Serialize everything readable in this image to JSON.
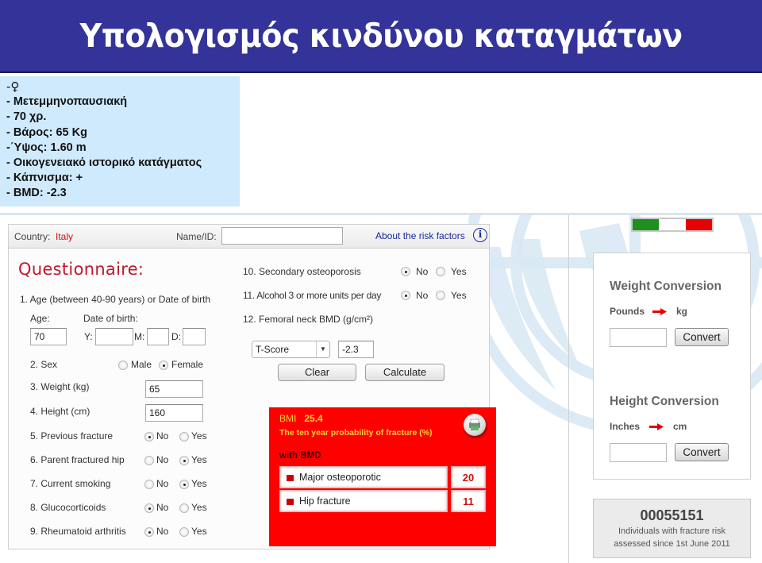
{
  "slide": {
    "title": "Υπολογισμός κινδύνου καταγμάτων",
    "title_bg": "#333399"
  },
  "patient": {
    "lines": [
      "-♀",
      "- Μετεμμηνοπαυσιακή",
      "- 70 χρ.",
      "- Βάρος: 65 Kg",
      "-΄Υψος: 1.60 m",
      "- Οικογενειακό ιστορικό κατάγματος",
      "- Κάπνισμα: +",
      "- BMD: -2.3"
    ]
  },
  "topbar": {
    "country_label": "Country:",
    "country_value": "Italy",
    "name_label": "Name/ID:",
    "name_value": "",
    "about_link": "About the risk factors",
    "info_icon": "i"
  },
  "questionnaire": {
    "title": "Questionnaire:",
    "q1": {
      "label": "1. Age (between 40-90 years) or Date of birth",
      "age_label": "Age:",
      "age_value": "70",
      "dob_label": "Date of birth:",
      "y_label": "Y:",
      "m_label": "M:",
      "d_label": "D:",
      "y_value": "",
      "m_value": "",
      "d_value": ""
    },
    "q2": {
      "label": "2. Sex",
      "options": [
        "Male",
        "Female"
      ],
      "selected": "Female"
    },
    "q3": {
      "label": "3. Weight (kg)",
      "value": "65"
    },
    "q4": {
      "label": "4. Height (cm)",
      "value": "160"
    },
    "yesno": [
      {
        "label": "5. Previous fracture",
        "selected": "No"
      },
      {
        "label": "6. Parent fractured hip",
        "selected": "Yes"
      },
      {
        "label": "7. Current smoking",
        "selected": "Yes"
      },
      {
        "label": "8. Glucocorticoids",
        "selected": "No"
      },
      {
        "label": "9. Rheumatoid arthritis",
        "selected": "No"
      },
      {
        "label": "10. Secondary osteoporosis",
        "selected": "No"
      },
      {
        "label": "11. Alcohol 3 or more units per day",
        "selected": "No"
      }
    ],
    "no_label": "No",
    "yes_label": "Yes",
    "q12": {
      "label": "12. Femoral neck BMD  (g/cm²)",
      "select_value": "T-Score",
      "bmd_value": "-2.3"
    },
    "clear_button": "Clear",
    "calculate_button": "Calculate"
  },
  "result": {
    "bmi_label": "BMI",
    "bmi_value": "25.4",
    "probability_title": "The ten year probability of fracture (%)",
    "with_bmd": "with BMD",
    "rows": [
      {
        "label": "Major osteoporotic",
        "value": "20"
      },
      {
        "label": "Hip fracture",
        "value": "11"
      }
    ],
    "bg_color": "#ff0000"
  },
  "flag": {
    "colors": [
      "#1f8f1f",
      "#ffffff",
      "#e60000"
    ]
  },
  "weight_conversion": {
    "title": "Weight Conversion",
    "from": "Pounds",
    "to": "kg",
    "input_value": "",
    "button": "Convert"
  },
  "height_conversion": {
    "title": "Height Conversion",
    "from": "Inches",
    "to": "cm",
    "input_value": "",
    "button": "Convert"
  },
  "counter": {
    "number": "00055151",
    "line1": "Individuals with fracture risk",
    "line2": "assessed since 1st June 2011"
  }
}
